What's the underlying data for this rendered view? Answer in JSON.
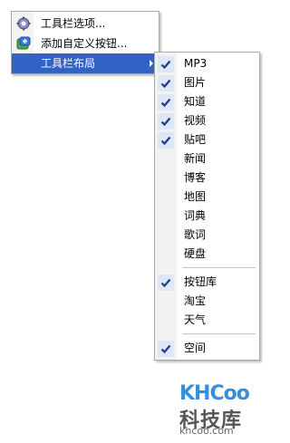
{
  "main_menu": {
    "items": [
      {
        "label": "工具栏选项...",
        "icon": "gear-icon"
      },
      {
        "label": "添加自定义按钮...",
        "icon": "add-button-icon"
      },
      {
        "label": "工具栏布局",
        "icon": "",
        "highlighted": true,
        "submenu_arrow": "chevron-right-icon"
      }
    ]
  },
  "submenu": {
    "groups": [
      [
        {
          "label": "MP3",
          "checked": true
        },
        {
          "label": "图片",
          "checked": true
        },
        {
          "label": "知道",
          "checked": true
        },
        {
          "label": "视频",
          "checked": true
        },
        {
          "label": "贴吧",
          "checked": true
        },
        {
          "label": "新闻",
          "checked": false
        },
        {
          "label": "博客",
          "checked": false
        },
        {
          "label": "地图",
          "checked": false
        },
        {
          "label": "词典",
          "checked": false
        },
        {
          "label": "歌词",
          "checked": false
        },
        {
          "label": "硬盘",
          "checked": false
        }
      ],
      [
        {
          "label": "按钮库",
          "checked": true
        },
        {
          "label": "淘宝",
          "checked": false
        },
        {
          "label": "天气",
          "checked": false
        }
      ],
      [
        {
          "label": "空间",
          "checked": true
        }
      ]
    ]
  },
  "watermark": {
    "logo": "KHCoo",
    "cn": "科技库",
    "url": "khcoo.com"
  },
  "colors": {
    "highlight": "#3163c5",
    "check": "#1a3c8a",
    "check_bg": "#dfe6f5",
    "brand": "#3a8ed8"
  }
}
